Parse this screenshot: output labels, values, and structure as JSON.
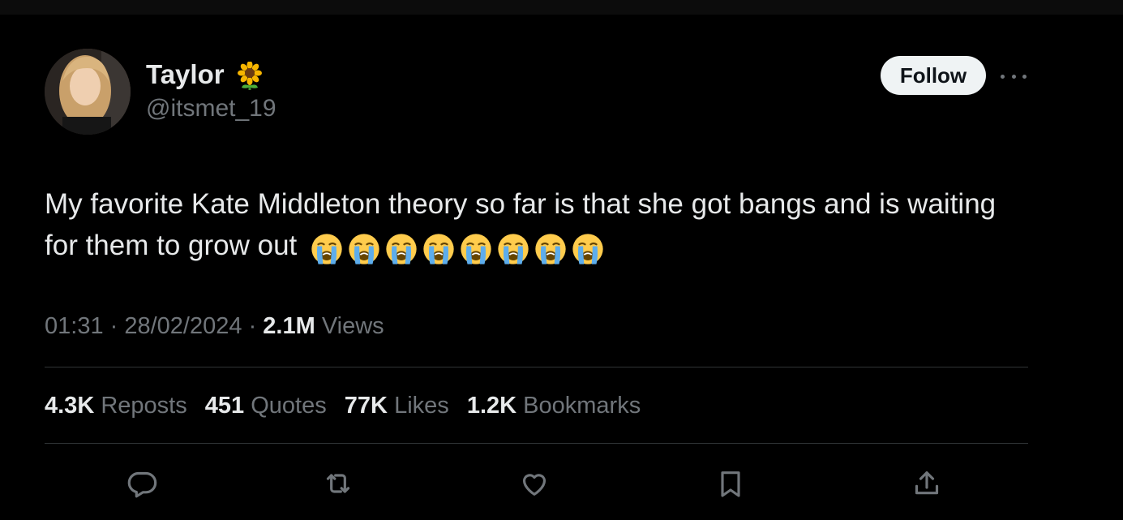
{
  "user": {
    "display_name": "Taylor",
    "name_emoji": "sunflower",
    "handle": "@itsmet_19",
    "avatar": "profile-photo"
  },
  "follow_label": "Follow",
  "more_icon": "more-dots-icon",
  "tweet": {
    "text": "My favorite Kate Middleton theory so far is that she got bangs and is waiting for them to grow out",
    "emoji": "loudly-crying-face",
    "emoji_count": 8
  },
  "meta": {
    "time": "01:31",
    "date": "28/02/2024",
    "views_count": "2.1M",
    "views_label": "Views"
  },
  "stats": [
    {
      "count": "4.3K",
      "label": "Reposts"
    },
    {
      "count": "451",
      "label": "Quotes"
    },
    {
      "count": "77K",
      "label": "Likes"
    },
    {
      "count": "1.2K",
      "label": "Bookmarks"
    }
  ],
  "actions": [
    "reply-icon",
    "repost-icon",
    "like-icon",
    "bookmark-icon",
    "share-icon"
  ],
  "colors": {
    "background": "#000000",
    "text": "#e7e9ea",
    "secondary": "#71767b",
    "divider": "#2f3336",
    "button_bg": "#eff3f4"
  }
}
